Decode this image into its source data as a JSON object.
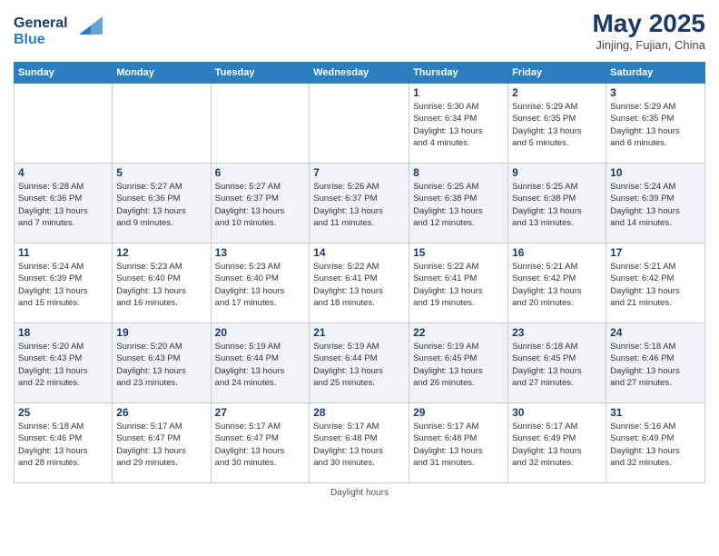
{
  "logo": {
    "line1": "General",
    "line2": "Blue"
  },
  "title": "May 2025",
  "subtitle": "Jinjing, Fujian, China",
  "days_of_week": [
    "Sunday",
    "Monday",
    "Tuesday",
    "Wednesday",
    "Thursday",
    "Friday",
    "Saturday"
  ],
  "weeks": [
    [
      {
        "day": "",
        "info": ""
      },
      {
        "day": "",
        "info": ""
      },
      {
        "day": "",
        "info": ""
      },
      {
        "day": "",
        "info": ""
      },
      {
        "day": "1",
        "info": "Sunrise: 5:30 AM\nSunset: 6:34 PM\nDaylight: 13 hours\nand 4 minutes."
      },
      {
        "day": "2",
        "info": "Sunrise: 5:29 AM\nSunset: 6:35 PM\nDaylight: 13 hours\nand 5 minutes."
      },
      {
        "day": "3",
        "info": "Sunrise: 5:29 AM\nSunset: 6:35 PM\nDaylight: 13 hours\nand 6 minutes."
      }
    ],
    [
      {
        "day": "4",
        "info": "Sunrise: 5:28 AM\nSunset: 6:36 PM\nDaylight: 13 hours\nand 7 minutes."
      },
      {
        "day": "5",
        "info": "Sunrise: 5:27 AM\nSunset: 6:36 PM\nDaylight: 13 hours\nand 9 minutes."
      },
      {
        "day": "6",
        "info": "Sunrise: 5:27 AM\nSunset: 6:37 PM\nDaylight: 13 hours\nand 10 minutes."
      },
      {
        "day": "7",
        "info": "Sunrise: 5:26 AM\nSunset: 6:37 PM\nDaylight: 13 hours\nand 11 minutes."
      },
      {
        "day": "8",
        "info": "Sunrise: 5:25 AM\nSunset: 6:38 PM\nDaylight: 13 hours\nand 12 minutes."
      },
      {
        "day": "9",
        "info": "Sunrise: 5:25 AM\nSunset: 6:38 PM\nDaylight: 13 hours\nand 13 minutes."
      },
      {
        "day": "10",
        "info": "Sunrise: 5:24 AM\nSunset: 6:39 PM\nDaylight: 13 hours\nand 14 minutes."
      }
    ],
    [
      {
        "day": "11",
        "info": "Sunrise: 5:24 AM\nSunset: 6:39 PM\nDaylight: 13 hours\nand 15 minutes."
      },
      {
        "day": "12",
        "info": "Sunrise: 5:23 AM\nSunset: 6:40 PM\nDaylight: 13 hours\nand 16 minutes."
      },
      {
        "day": "13",
        "info": "Sunrise: 5:23 AM\nSunset: 6:40 PM\nDaylight: 13 hours\nand 17 minutes."
      },
      {
        "day": "14",
        "info": "Sunrise: 5:22 AM\nSunset: 6:41 PM\nDaylight: 13 hours\nand 18 minutes."
      },
      {
        "day": "15",
        "info": "Sunrise: 5:22 AM\nSunset: 6:41 PM\nDaylight: 13 hours\nand 19 minutes."
      },
      {
        "day": "16",
        "info": "Sunrise: 5:21 AM\nSunset: 6:42 PM\nDaylight: 13 hours\nand 20 minutes."
      },
      {
        "day": "17",
        "info": "Sunrise: 5:21 AM\nSunset: 6:42 PM\nDaylight: 13 hours\nand 21 minutes."
      }
    ],
    [
      {
        "day": "18",
        "info": "Sunrise: 5:20 AM\nSunset: 6:43 PM\nDaylight: 13 hours\nand 22 minutes."
      },
      {
        "day": "19",
        "info": "Sunrise: 5:20 AM\nSunset: 6:43 PM\nDaylight: 13 hours\nand 23 minutes."
      },
      {
        "day": "20",
        "info": "Sunrise: 5:19 AM\nSunset: 6:44 PM\nDaylight: 13 hours\nand 24 minutes."
      },
      {
        "day": "21",
        "info": "Sunrise: 5:19 AM\nSunset: 6:44 PM\nDaylight: 13 hours\nand 25 minutes."
      },
      {
        "day": "22",
        "info": "Sunrise: 5:19 AM\nSunset: 6:45 PM\nDaylight: 13 hours\nand 26 minutes."
      },
      {
        "day": "23",
        "info": "Sunrise: 5:18 AM\nSunset: 6:45 PM\nDaylight: 13 hours\nand 27 minutes."
      },
      {
        "day": "24",
        "info": "Sunrise: 5:18 AM\nSunset: 6:46 PM\nDaylight: 13 hours\nand 27 minutes."
      }
    ],
    [
      {
        "day": "25",
        "info": "Sunrise: 5:18 AM\nSunset: 6:46 PM\nDaylight: 13 hours\nand 28 minutes."
      },
      {
        "day": "26",
        "info": "Sunrise: 5:17 AM\nSunset: 6:47 PM\nDaylight: 13 hours\nand 29 minutes."
      },
      {
        "day": "27",
        "info": "Sunrise: 5:17 AM\nSunset: 6:47 PM\nDaylight: 13 hours\nand 30 minutes."
      },
      {
        "day": "28",
        "info": "Sunrise: 5:17 AM\nSunset: 6:48 PM\nDaylight: 13 hours\nand 30 minutes."
      },
      {
        "day": "29",
        "info": "Sunrise: 5:17 AM\nSunset: 6:48 PM\nDaylight: 13 hours\nand 31 minutes."
      },
      {
        "day": "30",
        "info": "Sunrise: 5:17 AM\nSunset: 6:49 PM\nDaylight: 13 hours\nand 32 minutes."
      },
      {
        "day": "31",
        "info": "Sunrise: 5:16 AM\nSunset: 6:49 PM\nDaylight: 13 hours\nand 32 minutes."
      }
    ]
  ],
  "footer": "Daylight hours"
}
